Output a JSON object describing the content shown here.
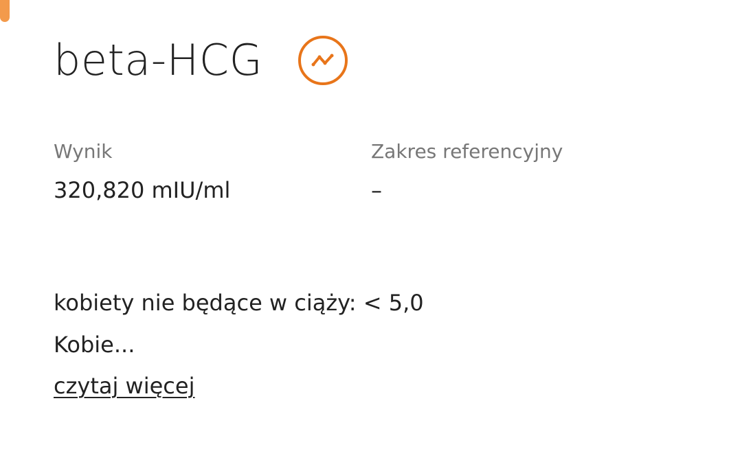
{
  "header": {
    "title": "beta-HCG",
    "trend_icon": "trend-line-icon",
    "accent_color": "#e8751a"
  },
  "result": {
    "label": "Wynik",
    "value": "320,820 mIU/ml"
  },
  "reference": {
    "label": "Zakres referencyjny",
    "value": "–"
  },
  "notes": {
    "line1": "kobiety nie będące w ciąży: < 5,0",
    "line2": "Kobie..."
  },
  "read_more_label": "czytaj więcej"
}
